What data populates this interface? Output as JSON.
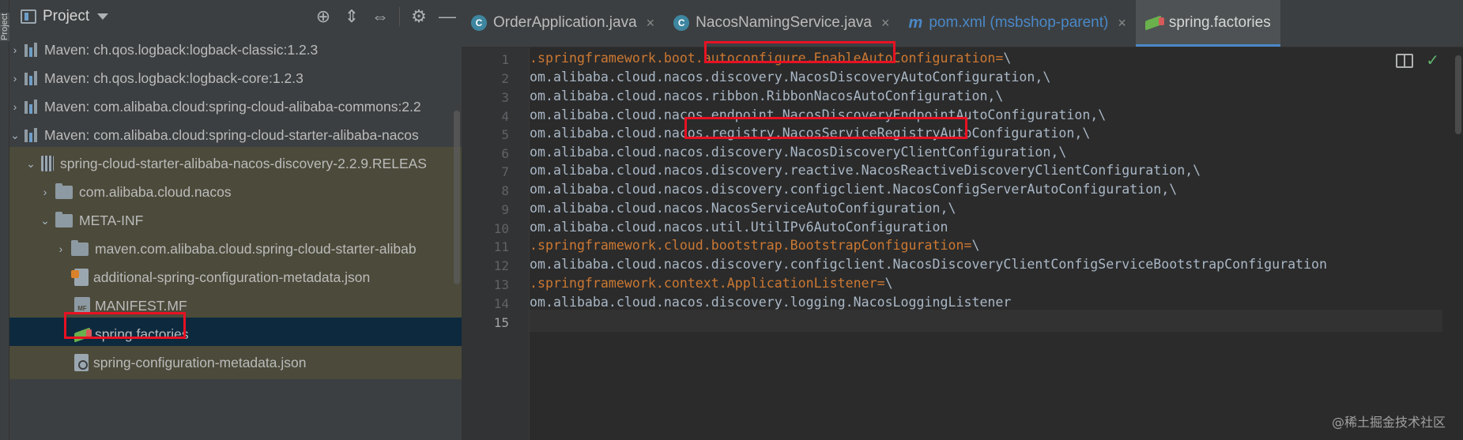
{
  "sidebar_stripe": {
    "label": "Project"
  },
  "project_panel": {
    "title": "Project",
    "toolbar_icons": [
      "locate-icon",
      "expand-all-icon",
      "collapse-all-icon",
      "gear-icon",
      "minimize-icon"
    ],
    "tree": [
      {
        "label": "Maven: ch.qos.logback:logback-classic:1.2.3",
        "icon": "library-icon",
        "expanded": false
      },
      {
        "label": "Maven: ch.qos.logback:logback-core:1.2.3",
        "icon": "library-icon",
        "expanded": false
      },
      {
        "label": "Maven: com.alibaba.cloud:spring-cloud-alibaba-commons:2.2",
        "icon": "library-icon",
        "expanded": false
      },
      {
        "label": "Maven: com.alibaba.cloud:spring-cloud-starter-alibaba-nacos",
        "icon": "library-icon",
        "expanded": true
      },
      {
        "label": "spring-cloud-starter-alibaba-nacos-discovery-2.2.9.RELEAS",
        "icon": "jar-icon",
        "expanded": true
      },
      {
        "label": "com.alibaba.cloud.nacos",
        "icon": "folder-icon",
        "expanded": false
      },
      {
        "label": "META-INF",
        "icon": "folder-icon",
        "expanded": true
      },
      {
        "label": "maven.com.alibaba.cloud.spring-cloud-starter-alibab",
        "icon": "folder-icon",
        "expanded": false
      },
      {
        "label": "additional-spring-configuration-metadata.json",
        "icon": "json-file-icon"
      },
      {
        "label": "MANIFEST.MF",
        "icon": "manifest-file-icon"
      },
      {
        "label": "spring.factories",
        "icon": "spring-factories-icon",
        "selected": true
      },
      {
        "label": "spring-configuration-metadata.json",
        "icon": "json-file-icon"
      }
    ]
  },
  "editor": {
    "tabs": [
      {
        "label": "OrderApplication.java",
        "icon": "java-class-icon",
        "active": false
      },
      {
        "label": "NacosNamingService.java",
        "icon": "java-class-icon",
        "active": false
      },
      {
        "label": "pom.xml (msbshop-parent)",
        "icon": "maven-icon",
        "active": false
      },
      {
        "label": "spring.factories",
        "icon": "spring-factories-icon",
        "active": true
      }
    ],
    "line_numbers": [
      "1",
      "2",
      "3",
      "4",
      "5",
      "6",
      "7",
      "8",
      "9",
      "10",
      "11",
      "12",
      "13",
      "14",
      "15"
    ],
    "current_line": "15",
    "lines": [
      {
        "key": ".springframework.boot.autoconfigure.EnableAutoConfiguration=",
        "rest": "\\"
      },
      {
        "key": "",
        "rest": "om.alibaba.cloud.nacos.discovery.NacosDiscoveryAutoConfiguration,\\"
      },
      {
        "key": "",
        "rest": "om.alibaba.cloud.nacos.ribbon.RibbonNacosAutoConfiguration,\\"
      },
      {
        "key": "",
        "rest": "om.alibaba.cloud.nacos.endpoint.NacosDiscoveryEndpointAutoConfiguration,\\"
      },
      {
        "key": "",
        "rest": "om.alibaba.cloud.nacos.registry.NacosServiceRegistryAutoConfiguration,\\"
      },
      {
        "key": "",
        "rest": "om.alibaba.cloud.nacos.discovery.NacosDiscoveryClientConfiguration,\\"
      },
      {
        "key": "",
        "rest": "om.alibaba.cloud.nacos.discovery.reactive.NacosReactiveDiscoveryClientConfiguration,\\"
      },
      {
        "key": "",
        "rest": "om.alibaba.cloud.nacos.discovery.configclient.NacosConfigServerAutoConfiguration,\\"
      },
      {
        "key": "",
        "rest": "om.alibaba.cloud.nacos.NacosServiceAutoConfiguration,\\"
      },
      {
        "key": "",
        "rest": "om.alibaba.cloud.nacos.util.UtilIPv6AutoConfiguration"
      },
      {
        "key": ".springframework.cloud.bootstrap.BootstrapConfiguration=",
        "rest": "\\"
      },
      {
        "key": "",
        "rest": "om.alibaba.cloud.nacos.discovery.configclient.NacosDiscoveryClientConfigServiceBootstrapConfiguration"
      },
      {
        "key": ".springframework.context.ApplicationListener=",
        "rest": "\\"
      },
      {
        "key": "",
        "rest": "om.alibaba.cloud.nacos.discovery.logging.NacosLoggingListener"
      },
      {
        "key": "",
        "rest": ""
      }
    ],
    "right_icons": [
      "reader-mode-icon",
      "inspection-ok-icon"
    ]
  },
  "watermark": "@稀土掘金技术社区",
  "colors": {
    "panel_bg": "#3c3f41",
    "editor_bg": "#2b2b2b",
    "selection": "#0d293e",
    "highlight_box": "#e81123",
    "key": "#cc7832",
    "text": "#a9b7c6"
  }
}
